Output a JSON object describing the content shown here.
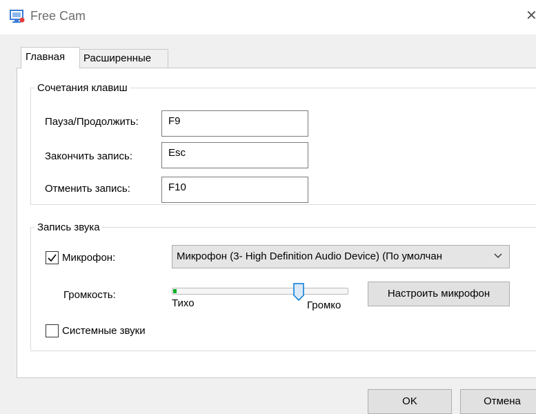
{
  "window": {
    "title": "Free Cam"
  },
  "tabs": [
    {
      "label": "Главная",
      "active": true
    },
    {
      "label": "Расширенные",
      "active": false
    }
  ],
  "hotkeys": {
    "legend": "Сочетания клавиш",
    "pause": {
      "label": "Пауза/Продолжить:",
      "value": "F9"
    },
    "finish": {
      "label": "Закончить запись:",
      "value": "Esc"
    },
    "cancel": {
      "label": "Отменить запись:",
      "value": "F10"
    }
  },
  "audio": {
    "legend": "Запись звука",
    "microphone": {
      "label": "Микрофон:",
      "checked": true,
      "selected": "Микрофон (3- High Definition Audio Device) (По умолчан"
    },
    "volume": {
      "label": "Громкость:",
      "level_percent": 72,
      "min_label": "Тихо",
      "max_label": "Громко"
    },
    "configure_button": "Настроить микрофон",
    "system_sounds": {
      "label": "Системные звуки",
      "checked": false
    }
  },
  "footer": {
    "ok": "OK",
    "cancel": "Отмена"
  },
  "colors": {
    "slider_fill": "#06b025",
    "slider_thumb": "#0078d7"
  }
}
